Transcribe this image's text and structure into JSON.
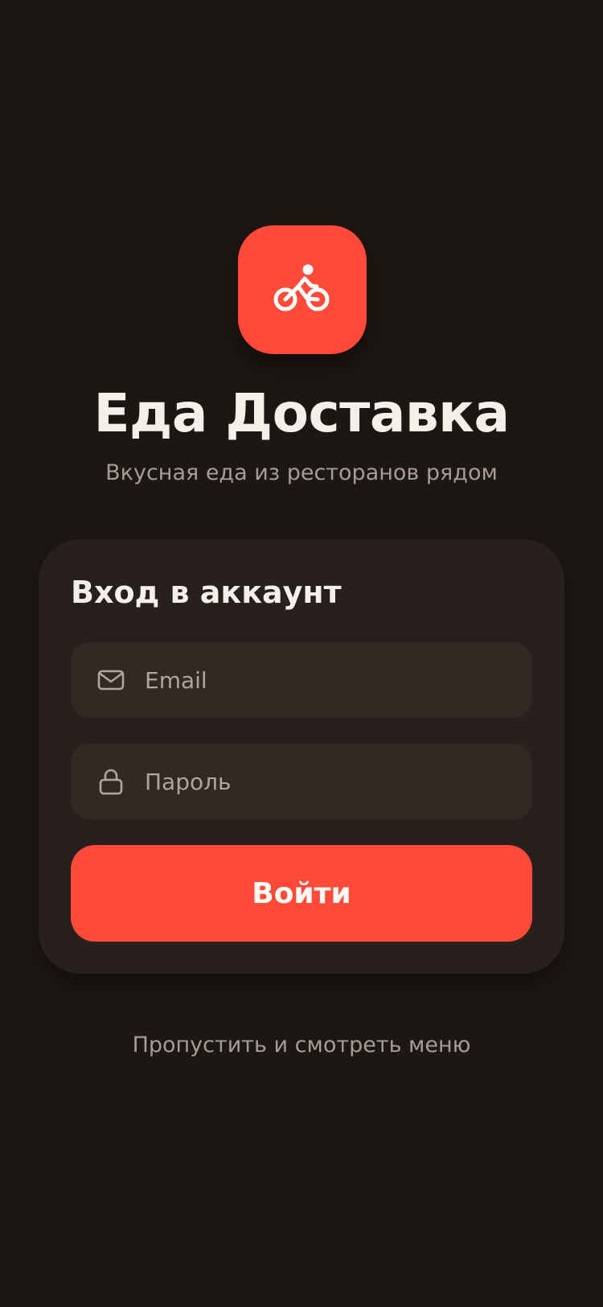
{
  "app": {
    "title": "Еда Доставка",
    "subtitle": "Вкусная еда из ресторанов рядом",
    "logo_icon": "bike-courier-icon"
  },
  "login_card": {
    "title": "Вход в аккаунт",
    "email_field": {
      "placeholder": "Email",
      "value": "",
      "icon": "mail-icon"
    },
    "password_field": {
      "placeholder": "Пароль",
      "value": "",
      "icon": "lock-icon"
    },
    "submit_label": "Войти"
  },
  "skip_link": "Пропустить и смотреть меню",
  "colors": {
    "background": "#1c1715",
    "card": "#28201d",
    "field": "#322824",
    "accent": "#ff4a3a",
    "text_primary": "#f5efe9",
    "text_secondary": "#a79c94"
  }
}
